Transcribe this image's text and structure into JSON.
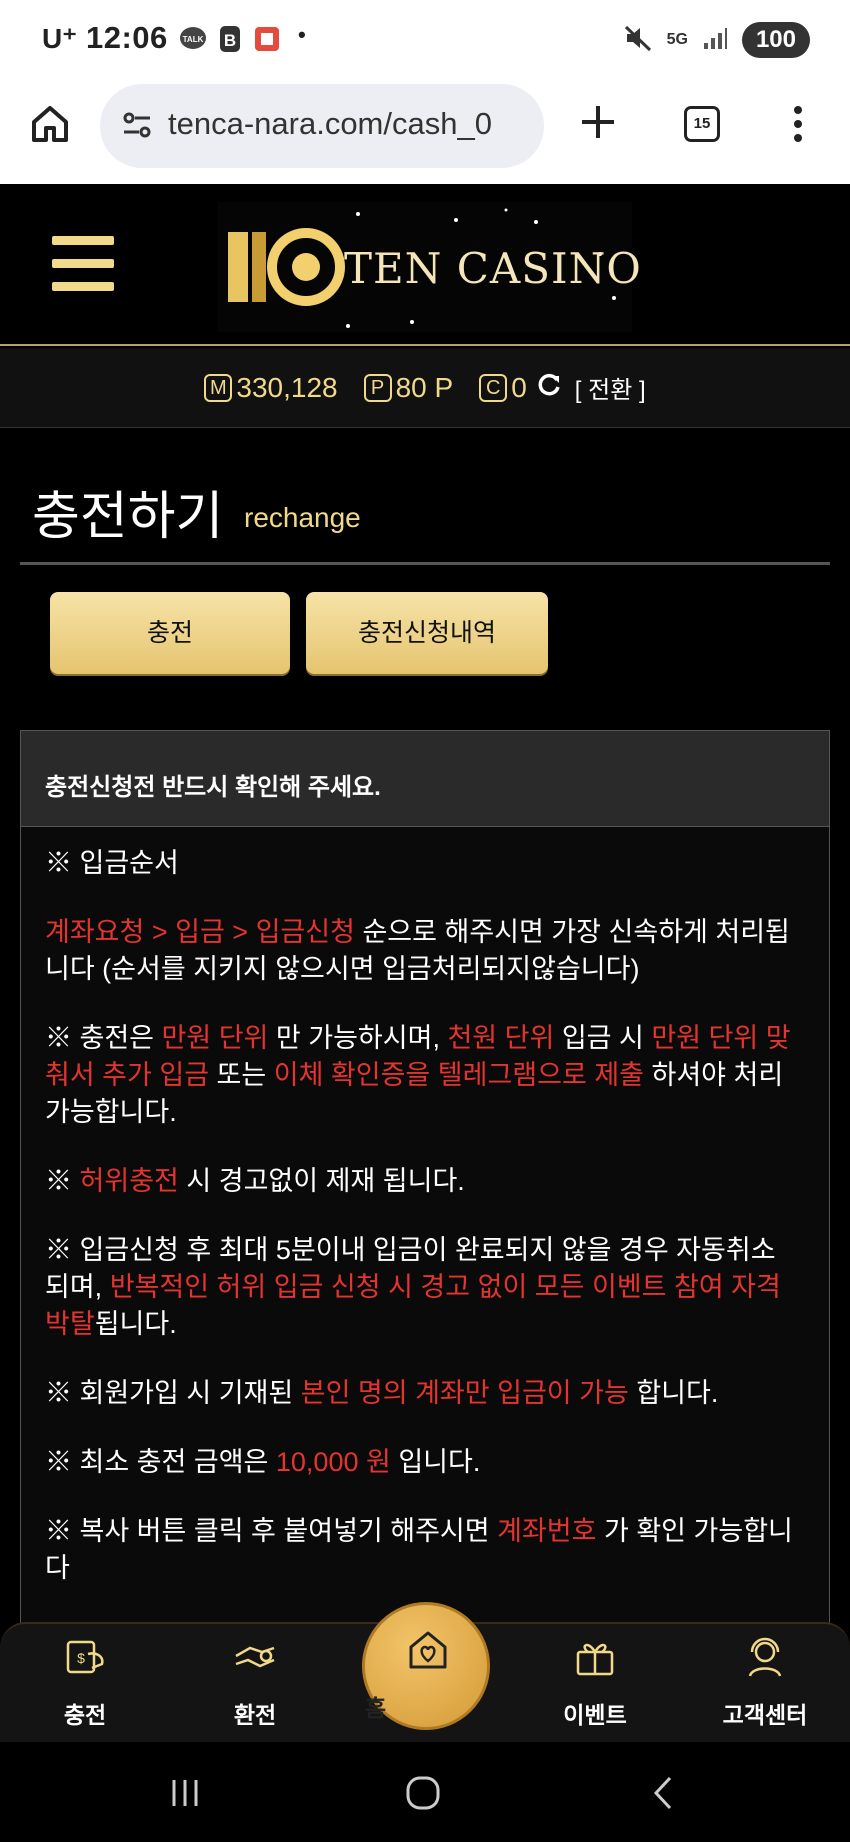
{
  "status_bar": {
    "carrier": "U⁺",
    "time": "12:06",
    "network": "5G",
    "battery": "100"
  },
  "browser": {
    "url": "tenca-nara.com/cash_0",
    "tab_count": "15"
  },
  "header": {
    "logo_text": "TEN CASINO"
  },
  "balance": {
    "m_label": "M",
    "m_value": "330,128",
    "p_label": "P",
    "p_value": "80 P",
    "c_label": "C",
    "c_value": "0",
    "convert_label": "[ 전환 ]"
  },
  "page": {
    "title": "충전하기",
    "subtitle": "rechange"
  },
  "tabs": {
    "recharge": "충전",
    "history": "충전신청내역"
  },
  "notice": {
    "heading": "충전신청전 반드시 확인해 주세요.",
    "p1": "※ 입금순서",
    "p2_red": "계좌요청 > 입금 > 입금신청",
    "p2_text": " 순으로 해주시면 가장 신속하게 처리됩니다 (순서를 지키지 않으시면 입금처리되지않습니다)",
    "p3_a": "※ 충전은 ",
    "p3_red1": "만원 단위",
    "p3_b": " 만 가능하시며, ",
    "p3_red2": "천원 단위",
    "p3_c": " 입금 시 ",
    "p3_red3": "만원 단위 맞춰서 추가 입금",
    "p3_d": " 또는 ",
    "p3_red4": "이체 확인증을 텔레그램으로 제출",
    "p3_e": " 하셔야 처리 가능합니다.",
    "p4_a": "※ ",
    "p4_red": "허위충전",
    "p4_b": " 시 경고없이 제재 됩니다.",
    "p5_a": "※ 입금신청 후 최대 5분이내 입금이 완료되지 않을 경우 자동취소 되며, ",
    "p5_red": "반복적인 허위 입금 신청 시 경고 없이 모든 이벤트 참여 자격 박탈",
    "p5_b": "됩니다.",
    "p6_a": "※ 회원가입 시 기재된 ",
    "p6_red": "본인 명의 계좌만 입금이 가능",
    "p6_b": " 합니다.",
    "p7_a": "※ 최소 충전 금액은 ",
    "p7_red": "10,000 원",
    "p7_b": " 입니다.",
    "p8_a": "※ 복사 버튼 클릭 후 붙여넣기 해주시면 ",
    "p8_red": "계좌번호",
    "p8_b": " 가 확인 가능합니다"
  },
  "bottom_nav": {
    "recharge": "충전",
    "exchange": "환전",
    "home": "홈",
    "event": "이벤트",
    "support": "고객센터"
  },
  "colors": {
    "gold": "#f1d98a",
    "button_gold": "#e5c46f",
    "warning_red": "#e3342f",
    "background": "#000000"
  }
}
